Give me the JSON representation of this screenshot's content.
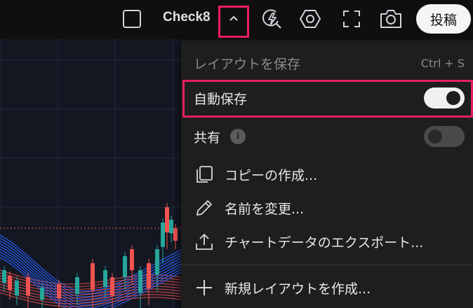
{
  "topbar": {
    "layout_name": "Check8",
    "publish_label": "投稿",
    "icons": [
      "square-icon",
      "chevron-up-icon",
      "alert-lightning-icon",
      "settings-hexagon-icon",
      "fullscreen-icon",
      "camera-icon"
    ]
  },
  "menu": {
    "header": "レイアウトを保存",
    "header_shortcut": "Ctrl + S",
    "autosave_label": "自動保存",
    "autosave_on": true,
    "share_label": "共有",
    "share_on": false,
    "copy_label": "コピーの作成...",
    "rename_label": "名前を変更...",
    "export_label": "チャートデータのエクスポート...",
    "new_layout_label": "新規レイアウトを作成..."
  },
  "colors": {
    "highlight": "#e91e63",
    "toggle_on": "#f0f0f0",
    "toggle_off": "#4a4a4a",
    "candle_up": "#26a69a",
    "candle_down": "#ef5350",
    "ribbon_blue": "#2962ff",
    "ribbon_red": "#ef5350"
  }
}
